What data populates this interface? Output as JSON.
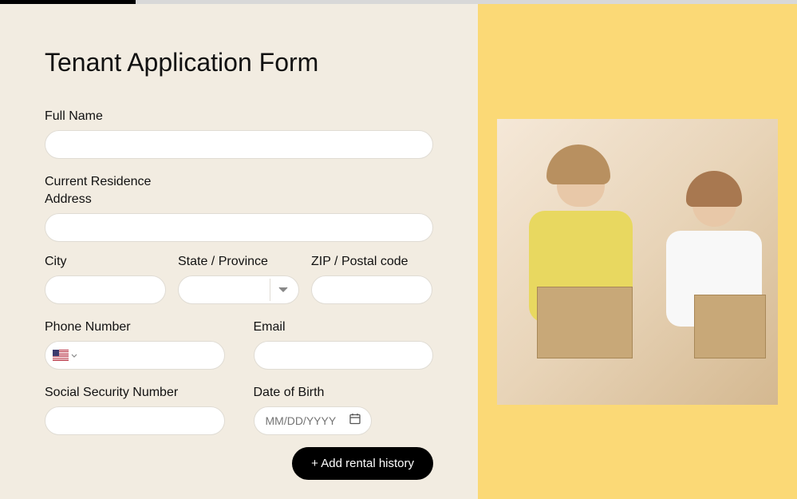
{
  "title": "Tenant Application Form",
  "fields": {
    "fullName": {
      "label": "Full Name",
      "value": ""
    },
    "currentResidence": {
      "section": "Current Residence"
    },
    "address": {
      "label": "Address",
      "value": ""
    },
    "city": {
      "label": "City",
      "value": ""
    },
    "state": {
      "label": "State / Province",
      "value": ""
    },
    "zip": {
      "label": "ZIP / Postal code",
      "value": ""
    },
    "phone": {
      "label": "Phone Number",
      "value": "",
      "country": "US"
    },
    "email": {
      "label": "Email",
      "value": ""
    },
    "ssn": {
      "label": "Social Security Number",
      "value": ""
    },
    "dob": {
      "label": "Date of Birth",
      "value": "",
      "placeholder": "MM/DD/YYYY"
    }
  },
  "buttons": {
    "addRentalHistory": "+ Add rental history"
  }
}
